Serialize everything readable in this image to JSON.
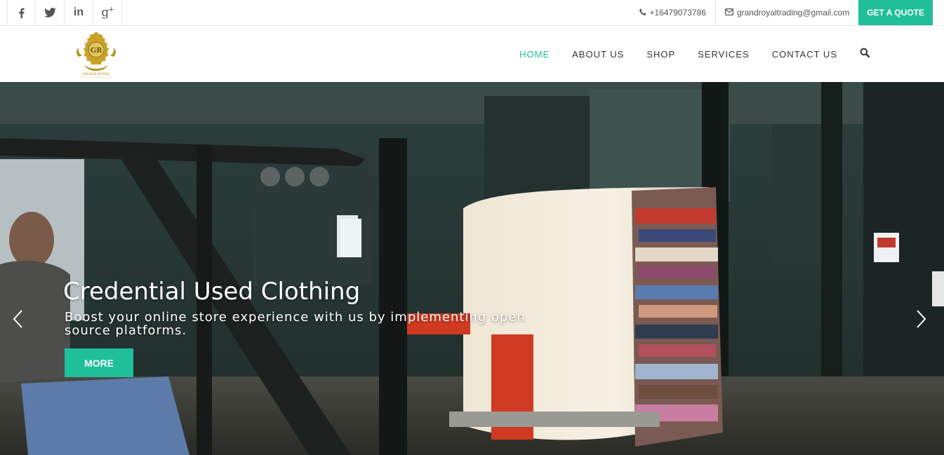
{
  "topbar": {
    "social": [
      {
        "icon": "facebook-icon"
      },
      {
        "icon": "twitter-icon"
      },
      {
        "icon": "linkedin-icon",
        "label": "in"
      },
      {
        "icon": "google-plus-icon",
        "label": "g",
        "sup": "+"
      }
    ],
    "phone": "+16479073786",
    "email": "grandroyaltrading@gmail.com",
    "quote_label": "GET A QUOTE"
  },
  "header": {
    "logo": {
      "monogram": "GR",
      "text": "GRAND ROYAL"
    },
    "nav": [
      {
        "label": "HOME",
        "active": true
      },
      {
        "label": "ABOUT US",
        "active": false
      },
      {
        "label": "SHOP",
        "active": false
      },
      {
        "label": "SERVICES",
        "active": false
      },
      {
        "label": "CONTACT US",
        "active": false
      }
    ],
    "search_icon": "search-icon"
  },
  "hero": {
    "title": "Credential Used Clothing",
    "subtitle": "Boost your online store experience with us by implementing open source platforms.",
    "button_label": "MORE",
    "prev_icon": "chevron-left-icon",
    "next_icon": "chevron-right-icon"
  },
  "colors": {
    "accent": "#1fbf9a",
    "text": "#333333",
    "muted": "#555555",
    "logo_gold": "#c9a227"
  }
}
